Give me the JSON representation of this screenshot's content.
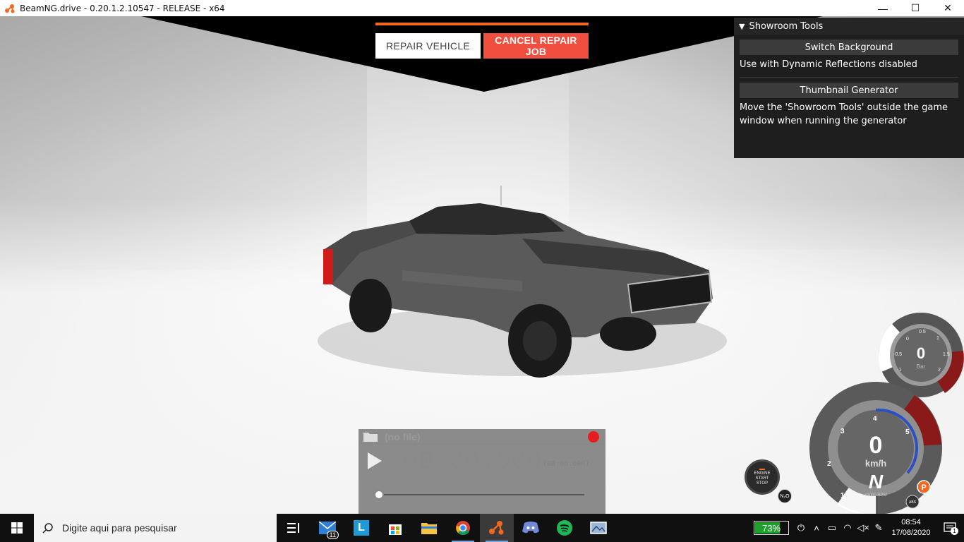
{
  "window": {
    "title": "BeamNG.drive - 0.20.1.2.10547 - RELEASE - x64",
    "minimize": "—",
    "maximize": "☐",
    "close": "✕"
  },
  "repair": {
    "repair_label": "REPAIR VEHICLE",
    "cancel_label": "CANCEL REPAIR JOB"
  },
  "showroom": {
    "title": "Showroom Tools",
    "switch_background": "Switch Background",
    "switch_note": "Use with Dynamic Reflections disabled",
    "thumbnail_generator": "Thumbnail Generator",
    "thumbnail_note": "Move the 'Showroom Tools' outside the game window when running the generator"
  },
  "replay": {
    "file": "(no file)",
    "time": "00:00.000",
    "time_small": "(00:00.000)"
  },
  "engine_button": {
    "line1": "ENGINE",
    "line2": "START",
    "line3": "STOP"
  },
  "boost_gauge": {
    "value": "0",
    "unit": "Bar",
    "ticks": [
      "-1",
      "-0.5",
      "0",
      "0.5",
      "1",
      "1.5",
      "2"
    ]
  },
  "speedo": {
    "speed": "0",
    "unit": "km/h",
    "gear": "N",
    "rpm_label": "x1000 RPM",
    "ticks": [
      "1",
      "2",
      "3",
      "4",
      "5"
    ],
    "park": "P",
    "abs": "ABS",
    "nos": "N₂O"
  },
  "taskbar": {
    "search_placeholder": "Digite aqui para pesquisar",
    "mail_badge": "11",
    "battery": "73%",
    "time": "08:54",
    "date": "17/08/2020",
    "notifications": "1"
  },
  "colors": {
    "accent_orange": "#f26722",
    "cancel_red": "#f04e3e",
    "gauge_red": "#9b1c1c",
    "battery_green": "#1fa02d"
  }
}
